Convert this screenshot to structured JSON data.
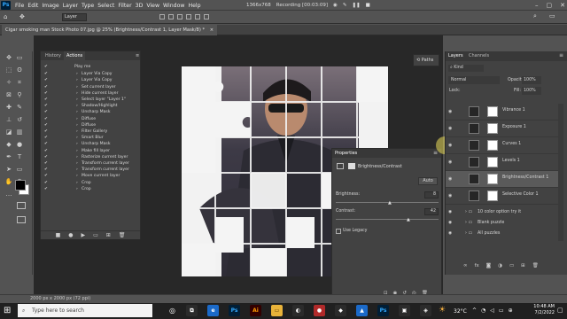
{
  "app": {
    "logo": "Ps"
  },
  "menu": [
    "File",
    "Edit",
    "Image",
    "Layer",
    "Type",
    "Select",
    "Filter",
    "3D",
    "View",
    "Window",
    "Help"
  ],
  "recording": {
    "resolution": "1366x768",
    "label": "Recording [00:03:09]"
  },
  "options": {
    "layer_dropdown": "Layer"
  },
  "document_tab": {
    "title": "Cigar smoking man Stock Photo 07.jpg @ 25% (Brightness/Contrast 1, Layer Mask/8) *",
    "close": "×"
  },
  "actions_panel": {
    "tabs": [
      "History",
      "Actions"
    ],
    "play_me": "Play me",
    "items": [
      "Layer Via Copy",
      "Layer Via Copy",
      "Set current layer",
      "Hide current layer",
      "Select layer \"Layer 1\"",
      "Shadow/Highlight",
      "Unsharp Mask",
      "Diffuse",
      "Diffuse",
      "Filter Gallery",
      "Smart Blur",
      "Unsharp Mask",
      "Make fill layer",
      "Rasterize current layer",
      "Transform current layer",
      "Transform current layer",
      "Move current layer",
      "Crop",
      "Crop"
    ]
  },
  "paths_button": "Paths",
  "properties": {
    "tab": "Properties",
    "title": "Brightness/Contrast",
    "auto": "Auto",
    "brightness_label": "Brightness:",
    "brightness_value": "8",
    "contrast_label": "Contrast:",
    "contrast_value": "42",
    "legacy": "Use Legacy"
  },
  "layers_panel": {
    "tabs": [
      "Layers",
      "Channels"
    ],
    "kind": "Kind",
    "blend": "Normal",
    "opacity_label": "Opacity:",
    "opacity": "100%",
    "lock_label": "Lock:",
    "fill_label": "Fill:",
    "fill": "100%",
    "layers": [
      "Vibrance 1",
      "Exposure 1",
      "Curves 1",
      "Levels 1",
      "Brightness/Contrast 1",
      "Selective Color 1"
    ],
    "groups": [
      "10 color option try it",
      "Blank puzzle",
      "All puzzles"
    ],
    "footer": [
      "fx"
    ]
  },
  "status": {
    "doc": "2000 px x 2000 px (72 ppi)"
  },
  "taskbar": {
    "search_placeholder": "Type here to search",
    "weather": "32°C",
    "time": "10:48 AM",
    "date": "7/2/2022"
  }
}
